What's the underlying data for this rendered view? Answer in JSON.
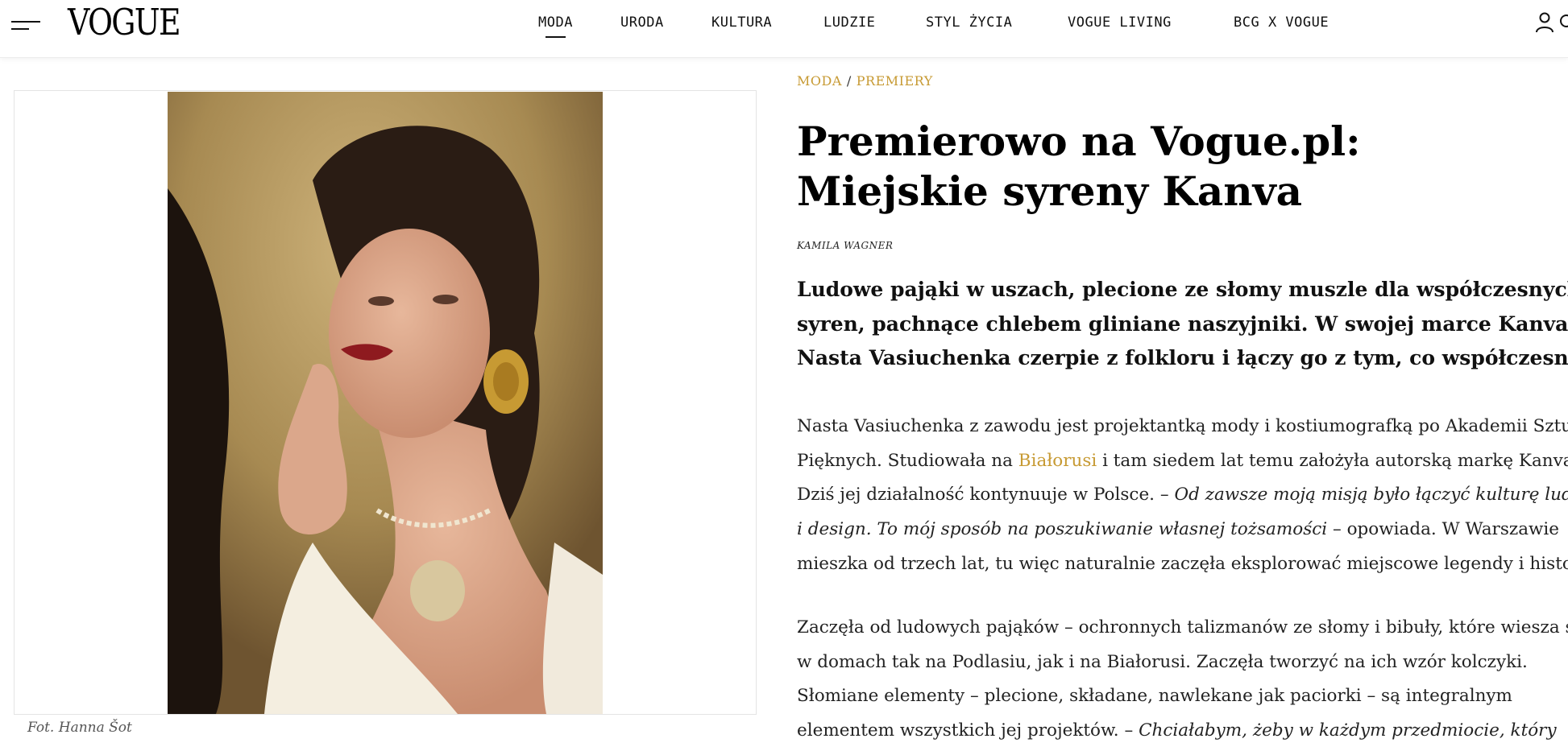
{
  "header": {
    "logo": "VOGUE",
    "nav": [
      {
        "label": "MODA",
        "active": true
      },
      {
        "label": "URODA",
        "active": false
      },
      {
        "label": "KULTURA",
        "active": false
      },
      {
        "label": "LUDZIE",
        "active": false
      },
      {
        "label": "STYL ŻYCIA",
        "active": false
      },
      {
        "label": "VOGUE LIVING",
        "active": false
      },
      {
        "label": "BCG X VOGUE",
        "active": false
      }
    ],
    "icons": {
      "menu": "hamburger-menu-icon",
      "user": "user-icon",
      "search": "search-icon"
    }
  },
  "image": {
    "caption": "Fot. Hanna Šot"
  },
  "article": {
    "breadcrumb": {
      "section": "MODA",
      "separator": "/",
      "subsection": "PREMIERY"
    },
    "title_line1": "Premierowo na Vogue.pl:",
    "title_line2": "Miejskie syreny Kanva",
    "author": "KAMILA WAGNER",
    "lead": [
      "Ludowe pająki w uszach, plecione ze słomy muszle dla współczesnych",
      "syren, pachnące chlebem gliniane naszyjniki. W swojej marce Kanva",
      "Nasta Vasiuchenka czerpie z folkloru i łączy go z tym, co współczesne."
    ],
    "p1": {
      "l1": "Nasta Vasiuchenka z zawodu jest projektantką mody i kostiumografką po Akademii Sztuk",
      "l2_a": "Pięknych. Studiowała na ",
      "l2_link": "Białorusi",
      "l2_b": " i tam siedem lat temu założyła autorską markę Kanva.",
      "l3_a": "Dziś jej działalność kontynuuje w Polsce. – ",
      "l3_em": "Od zawsze moją misją było łączyć kulturę ludową",
      "l4_em": "i design. To mój sposób na poszukiwanie własnej tożsamości",
      "l4_b": " – opowiada. W Warszawie",
      "l5": "mieszka od trzech lat, tu więc naturalnie zaczęła eksplorować miejscowe legendy i historie."
    },
    "p2": {
      "l1": "Zaczęła od ludowych pająków – ochronnych talizmanów ze słomy i bibuły, które wiesza się",
      "l2": "w domach tak na Podlasiu, jak i na Białorusi. Zaczęła tworzyć na ich wzór kolczyki.",
      "l3": "Słomiane elementy – plecione, składane, nawlekane jak paciorki – są integralnym",
      "l4_a": "elementem wszystkich jej projektów. – ",
      "l4_em": "Chciałabym, żeby w każdym przedmiocie, który"
    }
  },
  "colors": {
    "accent": "#c79a33",
    "text": "#111111",
    "border": "#e4e4e4"
  }
}
